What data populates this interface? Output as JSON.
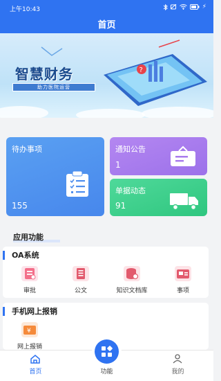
{
  "status_bar": {
    "time": "上午10:43",
    "battery": "⚡"
  },
  "header": {
    "title": "首页"
  },
  "banner": {
    "brand_text": "智慧财务",
    "subtag": "助力医院运营"
  },
  "cards": [
    {
      "label": "待办事项",
      "value": "155"
    },
    {
      "label": "通知公告",
      "value": "1"
    },
    {
      "label": "单据动态",
      "value": "91"
    }
  ],
  "section": {
    "title": "应用功能"
  },
  "oa": {
    "title": "OA系统",
    "items": [
      {
        "label": "审批",
        "icon": "approval-icon",
        "color": "#f36f8a"
      },
      {
        "label": "公文",
        "icon": "document-icon",
        "color": "#e25a6d"
      },
      {
        "label": "知识文档库",
        "icon": "knowledge-base-icon",
        "color": "#e25a6d"
      },
      {
        "label": "事项",
        "icon": "matters-icon",
        "color": "#e25a6d"
      }
    ]
  },
  "reimb": {
    "title": "手机网上报销",
    "items": [
      {
        "label": "网上报销",
        "icon": "yuan-icon",
        "color": "#f58a3a"
      }
    ]
  },
  "tabs": [
    {
      "label": "首页",
      "active": true
    },
    {
      "label": "功能",
      "active": false
    },
    {
      "label": "我的",
      "active": false
    }
  ],
  "colors": {
    "primary": "#2f73f1",
    "card_blue": "#4f92ef",
    "card_purple": "#a97ced",
    "card_green": "#3ccf8a"
  }
}
